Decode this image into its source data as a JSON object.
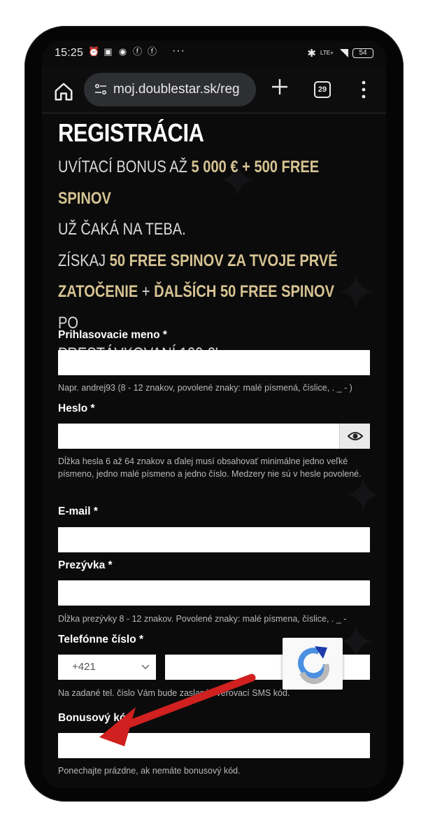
{
  "status_bar": {
    "time": "15:25",
    "battery": "54",
    "network": "LTE+"
  },
  "browser": {
    "url": "moj.doublestar.sk/reg",
    "tab_count": "29"
  },
  "page": {
    "title": "REGISTRÁCIA",
    "promo": {
      "l1_a": "UVÍTACÍ BONUS AŽ ",
      "l1_b": "5 000 € + 500 FREE SPINOV",
      "l2": "UŽ ČAKÁ NA TEBA.",
      "l3_a": "ZÍSKAJ ",
      "l3_b": "50 FREE SPINOV ZA TVOJE PRVÉ",
      "l4_a": "ZATOČENIE",
      "l4_b": " + ",
      "l4_c": "ĎALŠÍCH 50 FREE SPINOV",
      "l4_d": " PO",
      "l5": "PRESTÁVKOVANÍ 100 €!"
    }
  },
  "form": {
    "username": {
      "label": "Prihlasovacie meno *",
      "value": "",
      "hint": "Napr. andrej93 (8 - 12 znakov, povolené znaky: malé písmená, číslice, . _ - )"
    },
    "password": {
      "label": "Heslo *",
      "value": "",
      "hint": "Dĺžka hesla 6 až 64 znakov a ďalej musí obsahovať minimálne jedno veľké písmeno, jedno malé písmeno a jedno číslo. Medzery nie sú v hesle povolené."
    },
    "email": {
      "label": "E-mail *",
      "value": ""
    },
    "nickname": {
      "label": "Prezývka *",
      "value": "",
      "hint": "Dĺžka prezývky 8 - 12 znakov. Povolené znaky: malé písmena, číslice, . _ -"
    },
    "phone": {
      "label": "Telefónne číslo *",
      "prefix": "+421",
      "value": "",
      "hint": "Na zadané tel. číslo Vám bude zaslaný overovací SMS kód."
    },
    "bonus": {
      "label": "Bonusový kód",
      "value": "",
      "hint": "Ponechajte prázdne, ak nemáte bonusový kód."
    }
  },
  "colors": {
    "accent_gold": "#d6c392",
    "background": "#0b0b0c",
    "arrow": "#d0201f"
  }
}
